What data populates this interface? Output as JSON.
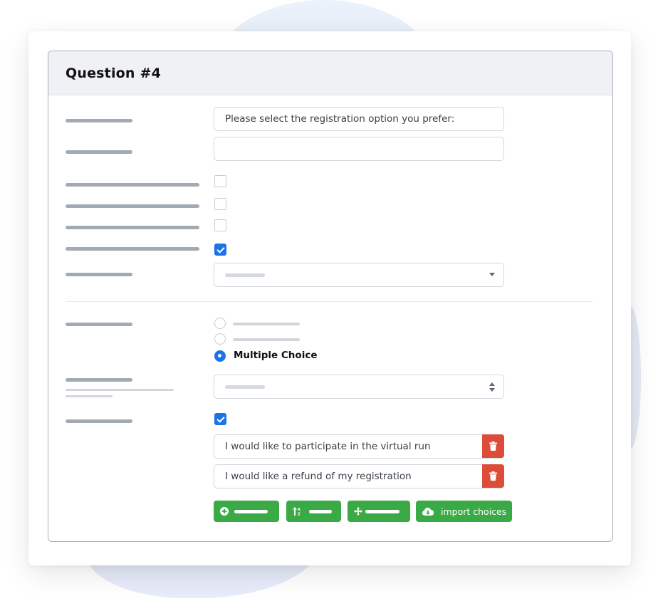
{
  "panel": {
    "title": "Question #4"
  },
  "fields": {
    "question_text_value": "Please select the registration option you prefer:",
    "secondary_text_value": "",
    "checkboxes": [
      {
        "checked": false
      },
      {
        "checked": false
      },
      {
        "checked": false
      },
      {
        "checked": true
      }
    ],
    "dropdown_selected": ""
  },
  "type_section": {
    "radio_options": [
      {
        "label": "",
        "selected": false
      },
      {
        "label": "",
        "selected": false
      },
      {
        "label": "Multiple Choice",
        "selected": true
      }
    ],
    "select_value": "",
    "checkbox_checked": true
  },
  "choices": [
    {
      "value": "I would like to participate in the virtual run"
    },
    {
      "value": "I would like a refund of my registration"
    }
  ],
  "buttons": {
    "add_choice_icon": "plus-circle-icon",
    "sort_icon": "sort-alpha-icon",
    "move_icon": "move-arrows-icon",
    "import_icon": "cloud-download-icon",
    "import_label": "import choices"
  },
  "colors": {
    "primary": "#1a73e8",
    "success": "#3aaa46",
    "danger": "#dd4b39"
  }
}
